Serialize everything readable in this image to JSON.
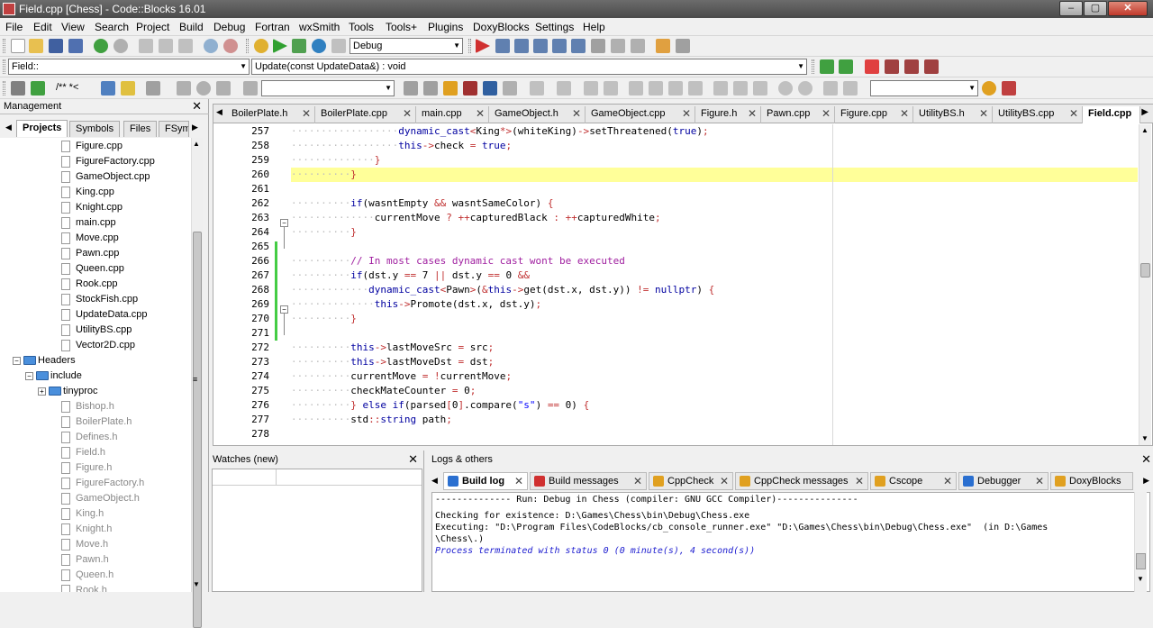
{
  "window": {
    "title": "Field.cpp [Chess] - Code::Blocks 16.01",
    "min": "–",
    "max": "▢",
    "close": "✕"
  },
  "menu": [
    "File",
    "Edit",
    "View",
    "Search",
    "Project",
    "Build",
    "Debug",
    "Fortran",
    "wxSmith",
    "Tools",
    "Tools+",
    "Plugins",
    "DoxyBlocks",
    "Settings",
    "Help"
  ],
  "toolbar": {
    "build_target": "Debug",
    "scope": "Field::",
    "function": "Update(const UpdateData&) : void",
    "comment_tool": "/** *<"
  },
  "management": {
    "title": "Management",
    "close": "✕",
    "tabs": [
      "Projects",
      "Symbols",
      "Files",
      "FSymbols"
    ],
    "tree": [
      {
        "label": "Figure.cpp",
        "type": "file",
        "indent": 5,
        "gray": false
      },
      {
        "label": "FigureFactory.cpp",
        "type": "file",
        "indent": 5,
        "gray": false
      },
      {
        "label": "GameObject.cpp",
        "type": "file",
        "indent": 5,
        "gray": false
      },
      {
        "label": "King.cpp",
        "type": "file",
        "indent": 5,
        "gray": false
      },
      {
        "label": "Knight.cpp",
        "type": "file",
        "indent": 5,
        "gray": false
      },
      {
        "label": "main.cpp",
        "type": "file",
        "indent": 5,
        "gray": false
      },
      {
        "label": "Move.cpp",
        "type": "file",
        "indent": 5,
        "gray": false
      },
      {
        "label": "Pawn.cpp",
        "type": "file",
        "indent": 5,
        "gray": false
      },
      {
        "label": "Queen.cpp",
        "type": "file",
        "indent": 5,
        "gray": false
      },
      {
        "label": "Rook.cpp",
        "type": "file",
        "indent": 5,
        "gray": false
      },
      {
        "label": "StockFish.cpp",
        "type": "file",
        "indent": 5,
        "gray": false
      },
      {
        "label": "UpdateData.cpp",
        "type": "file",
        "indent": 5,
        "gray": false
      },
      {
        "label": "UtilityBS.cpp",
        "type": "file",
        "indent": 5,
        "gray": false
      },
      {
        "label": "Vector2D.cpp",
        "type": "file",
        "indent": 5,
        "gray": false
      },
      {
        "label": "Headers",
        "type": "folder",
        "indent": 2,
        "gray": false
      },
      {
        "label": "include",
        "type": "folder",
        "indent": 3,
        "gray": false
      },
      {
        "label": "tinyproc",
        "type": "folder",
        "indent": 4,
        "gray": false
      },
      {
        "label": "Bishop.h",
        "type": "file",
        "indent": 5,
        "gray": true
      },
      {
        "label": "BoilerPlate.h",
        "type": "file",
        "indent": 5,
        "gray": true
      },
      {
        "label": "Defines.h",
        "type": "file",
        "indent": 5,
        "gray": true
      },
      {
        "label": "Field.h",
        "type": "file",
        "indent": 5,
        "gray": true
      },
      {
        "label": "Figure.h",
        "type": "file",
        "indent": 5,
        "gray": true
      },
      {
        "label": "FigureFactory.h",
        "type": "file",
        "indent": 5,
        "gray": true
      },
      {
        "label": "GameObject.h",
        "type": "file",
        "indent": 5,
        "gray": true
      },
      {
        "label": "King.h",
        "type": "file",
        "indent": 5,
        "gray": true
      },
      {
        "label": "Knight.h",
        "type": "file",
        "indent": 5,
        "gray": true
      },
      {
        "label": "Move.h",
        "type": "file",
        "indent": 5,
        "gray": true
      },
      {
        "label": "Pawn.h",
        "type": "file",
        "indent": 5,
        "gray": true
      },
      {
        "label": "Queen.h",
        "type": "file",
        "indent": 5,
        "gray": true
      },
      {
        "label": "Rook.h",
        "type": "file",
        "indent": 5,
        "gray": true
      }
    ]
  },
  "editor": {
    "tabs": [
      "BoilerPlate.h",
      "BoilerPlate.cpp",
      "main.cpp",
      "GameObject.h",
      "GameObject.cpp",
      "Figure.h",
      "Pawn.cpp",
      "Figure.cpp",
      "UtilityBS.h",
      "UtilityBS.cpp",
      "Field.cpp"
    ],
    "active_tab": "Field.cpp",
    "lines": [
      {
        "n": "257",
        "indent": "                  ",
        "segs": [
          [
            "kw",
            "dynamic_cast"
          ],
          [
            "op",
            "<"
          ],
          [
            "",
            "King"
          ],
          [
            "op",
            "*>"
          ],
          [
            "",
            "(whiteKing)"
          ],
          [
            "op",
            "->"
          ],
          [
            "",
            "setThreatened("
          ],
          [
            "kw",
            "true"
          ],
          [
            "",
            ")"
          ],
          [
            "op",
            ";"
          ]
        ]
      },
      {
        "n": "258",
        "indent": "                  ",
        "segs": [
          [
            "kw",
            "this"
          ],
          [
            "op",
            "->"
          ],
          [
            "",
            "check "
          ],
          [
            "op",
            "="
          ],
          [
            "",
            ""
          ],
          [
            "kw",
            " true"
          ],
          [
            "op",
            ";"
          ]
        ]
      },
      {
        "n": "259",
        "indent": "              ",
        "segs": [
          [
            "op",
            "}"
          ]
        ]
      },
      {
        "n": "260",
        "indent": "          ",
        "segs": [
          [
            "op",
            "}"
          ]
        ],
        "highlight": true
      },
      {
        "n": "261",
        "indent": "",
        "segs": []
      },
      {
        "n": "262",
        "indent": "          ",
        "segs": [
          [
            "kw",
            "if"
          ],
          [
            "",
            "(wasntEmpty "
          ],
          [
            "op",
            "&&"
          ],
          [
            "",
            " wasntSameColor) "
          ],
          [
            "op",
            "{"
          ]
        ]
      },
      {
        "n": "263",
        "indent": "              ",
        "segs": [
          [
            "",
            "currentMove "
          ],
          [
            "op",
            "?"
          ],
          [
            "",
            ""
          ],
          [
            "op",
            " ++"
          ],
          [
            "",
            "capturedBlack "
          ],
          [
            "op",
            ":"
          ],
          [
            "op",
            " ++"
          ],
          [
            "",
            "capturedWhite"
          ],
          [
            "op",
            ";"
          ]
        ]
      },
      {
        "n": "264",
        "indent": "          ",
        "segs": [
          [
            "op",
            "}"
          ]
        ]
      },
      {
        "n": "265",
        "indent": "",
        "segs": []
      },
      {
        "n": "266",
        "indent": "          ",
        "segs": [
          [
            "cm",
            "// In most cases dynamic cast wont be executed"
          ]
        ]
      },
      {
        "n": "267",
        "indent": "          ",
        "segs": [
          [
            "kw",
            "if"
          ],
          [
            "",
            "(dst.y "
          ],
          [
            "op",
            "=="
          ],
          [
            "",
            " 7 "
          ],
          [
            "op",
            "||"
          ],
          [
            "",
            " dst.y "
          ],
          [
            "op",
            "=="
          ],
          [
            "",
            " 0 "
          ],
          [
            "op",
            "&&"
          ]
        ]
      },
      {
        "n": "268",
        "indent": "             ",
        "segs": [
          [
            "kw",
            "dynamic_cast"
          ],
          [
            "op",
            "<"
          ],
          [
            "",
            "Pawn"
          ],
          [
            "op",
            ">"
          ],
          [
            "",
            "("
          ],
          [
            "op",
            "&"
          ],
          [
            "kw",
            "this"
          ],
          [
            "op",
            "->"
          ],
          [
            "",
            "get(dst.x, dst.y)) "
          ],
          [
            "op",
            "!="
          ],
          [
            "kw",
            " nullptr"
          ],
          [
            "",
            ") "
          ],
          [
            "op",
            "{"
          ]
        ]
      },
      {
        "n": "269",
        "indent": "              ",
        "segs": [
          [
            "kw",
            "this"
          ],
          [
            "op",
            "->"
          ],
          [
            "",
            "Promote(dst.x, dst.y)"
          ],
          [
            "op",
            ";"
          ]
        ]
      },
      {
        "n": "270",
        "indent": "          ",
        "segs": [
          [
            "op",
            "}"
          ]
        ]
      },
      {
        "n": "271",
        "indent": "",
        "segs": []
      },
      {
        "n": "272",
        "indent": "          ",
        "segs": [
          [
            "kw",
            "this"
          ],
          [
            "op",
            "->"
          ],
          [
            "",
            "lastMoveSrc "
          ],
          [
            "op",
            "="
          ],
          [
            "",
            " src"
          ],
          [
            "op",
            ";"
          ]
        ]
      },
      {
        "n": "273",
        "indent": "          ",
        "segs": [
          [
            "kw",
            "this"
          ],
          [
            "op",
            "->"
          ],
          [
            "",
            "lastMoveDst "
          ],
          [
            "op",
            "="
          ],
          [
            "",
            " dst"
          ],
          [
            "op",
            ";"
          ]
        ]
      },
      {
        "n": "274",
        "indent": "          ",
        "segs": [
          [
            "",
            "currentMove "
          ],
          [
            "op",
            "="
          ],
          [
            "op",
            " !"
          ],
          [
            "",
            "currentMove"
          ],
          [
            "op",
            ";"
          ]
        ]
      },
      {
        "n": "275",
        "indent": "          ",
        "segs": [
          [
            "",
            "checkMateCounter "
          ],
          [
            "op",
            "="
          ],
          [
            "",
            " 0"
          ],
          [
            "op",
            ";"
          ]
        ]
      },
      {
        "n": "276",
        "indent": "          ",
        "segs": [
          [
            "op",
            "}"
          ],
          [
            "kw",
            " else if"
          ],
          [
            "",
            "(parsed"
          ],
          [
            "op",
            "["
          ],
          [
            "",
            "0"
          ],
          [
            "op",
            "]"
          ],
          [
            "",
            ".compare("
          ],
          [
            "st",
            "\"s\""
          ],
          [
            "",
            ") "
          ],
          [
            "op",
            "=="
          ],
          [
            "",
            " 0) "
          ],
          [
            "op",
            "{"
          ]
        ]
      },
      {
        "n": "277",
        "indent": "          ",
        "segs": [
          [
            "",
            "std"
          ],
          [
            "op",
            "::"
          ],
          [
            "kw",
            "string"
          ],
          [
            "",
            " path"
          ],
          [
            "op",
            ";"
          ]
        ]
      },
      {
        "n": "278",
        "indent": "",
        "segs": []
      }
    ]
  },
  "watches": {
    "title": "Watches (new)",
    "close": "✕"
  },
  "logs": {
    "title": "Logs & others",
    "close": "✕",
    "tabs": [
      {
        "label": "Build log",
        "color": "#2a6fd0"
      },
      {
        "label": "Build messages",
        "color": "#d03030"
      },
      {
        "label": "CppCheck",
        "color": "#e0a020"
      },
      {
        "label": "CppCheck messages",
        "color": "#e0a020"
      },
      {
        "label": "Cscope",
        "color": "#e0a020"
      },
      {
        "label": "Debugger",
        "color": "#2a6fd0"
      },
      {
        "label": "DoxyBlocks",
        "color": "#e0a020"
      }
    ],
    "lines": [
      {
        "text": "-------------- Run: Debug in Chess (compiler: GNU GCC Compiler)---------------",
        "style": "normal"
      },
      {
        "text": "",
        "style": "normal"
      },
      {
        "text": "Checking for existence: D:\\Games\\Chess\\bin\\Debug\\Chess.exe",
        "style": "normal"
      },
      {
        "text": "Executing: \"D:\\Program Files\\CodeBlocks/cb_console_runner.exe\" \"D:\\Games\\Chess\\bin\\Debug\\Chess.exe\"  (in D:\\Games",
        "style": "normal"
      },
      {
        "text": "\\Chess\\.)",
        "style": "normal"
      },
      {
        "text": "Process terminated with status 0 (0 minute(s), 4 second(s))",
        "style": "italic-blue"
      }
    ]
  }
}
